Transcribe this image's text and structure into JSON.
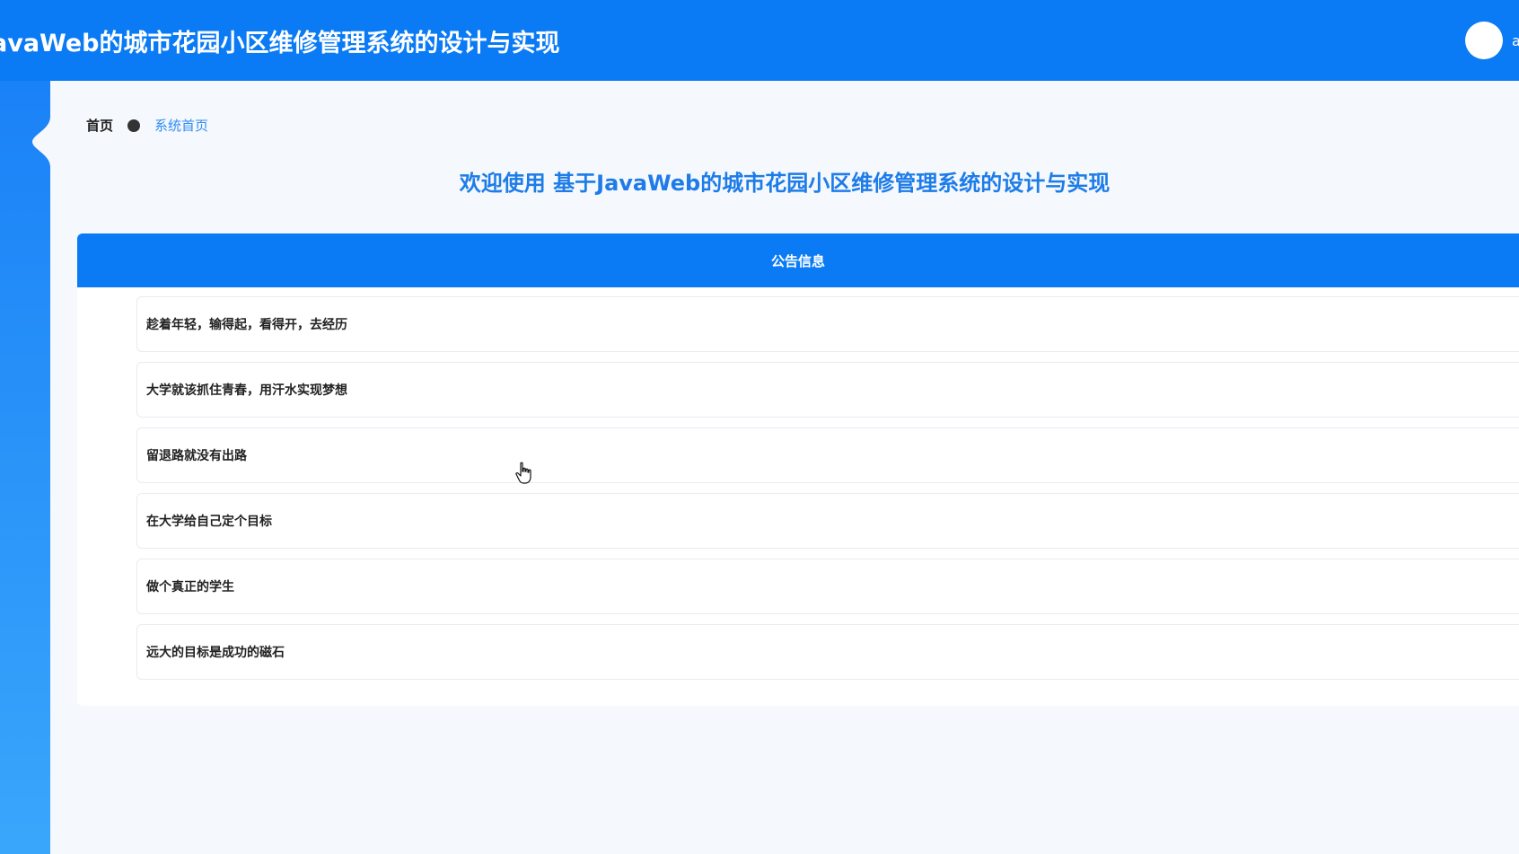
{
  "header": {
    "app_title": "avaWeb的城市花园小区维修管理系统的设计与实现",
    "user_name": "a"
  },
  "breadcrumb": {
    "home": "首页",
    "current": "系统首页"
  },
  "welcome_text": "欢迎使用 基于JavaWeb的城市花园小区维修管理系统的设计与实现",
  "notice_panel": {
    "title": "公告信息",
    "items": [
      "趁着年轻，输得起，看得开，去经历",
      "大学就该抓住青春，用汗水实现梦想",
      "留退路就没有出路",
      "在大学给自己定个目标",
      "做个真正的学生",
      "远大的目标是成功的磁石"
    ]
  },
  "colors": {
    "primary": "#0a7bf5",
    "accent_text": "#1d7ce8",
    "background": "#f5f8fc"
  }
}
